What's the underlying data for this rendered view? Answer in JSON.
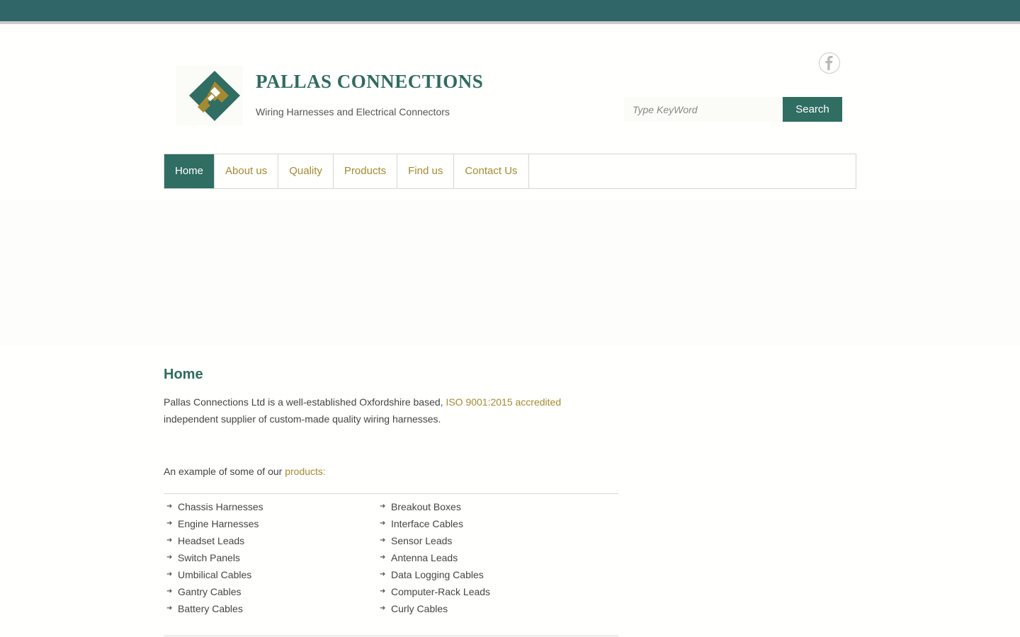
{
  "site": {
    "name": "PALLAS CONNECTIONS",
    "tagline": "Wiring Harnesses and Electrical Connectors",
    "colors": {
      "primary": "#306d63",
      "accent": "#a48a33",
      "topbar": "#306667"
    }
  },
  "social": {
    "facebook_icon": "facebook-icon"
  },
  "search": {
    "placeholder": "Type KeyWord",
    "value": "",
    "button_label": "Search"
  },
  "nav": {
    "items": [
      {
        "label": "Home",
        "active": true
      },
      {
        "label": "About us"
      },
      {
        "label": "Quality"
      },
      {
        "label": "Products"
      },
      {
        "label": "Find us"
      },
      {
        "label": "Contact Us"
      }
    ]
  },
  "main": {
    "title": "Home",
    "intro_before": "Pallas Connections Ltd is a well-established Oxfordshire based, ",
    "intro_link": "ISO 9001:2015 accredited",
    "intro_after": " independent supplier of custom-made quality wiring harnesses.",
    "example_text": "An example of some of our ",
    "example_link": "products:",
    "products_left": [
      "Chassis Harnesses",
      "Engine Harnesses",
      "Headset Leads",
      "Switch Panels",
      "Umbilical Cables",
      "Gantry Cables",
      "Battery Cables"
    ],
    "products_right": [
      "Breakout Boxes",
      "Interface Cables",
      "Sensor Leads",
      "Antenna Leads",
      "Data Logging Cables",
      "Computer-Rack Leads",
      "Curly Cables"
    ]
  }
}
